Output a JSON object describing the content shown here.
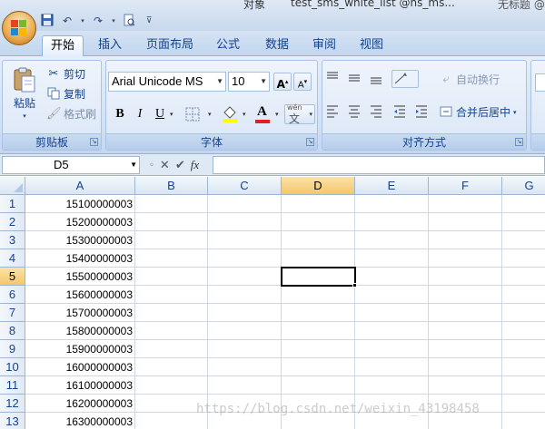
{
  "titlebar": {
    "partial_left_text": "对象",
    "file_name": "test_sms_white_list @ns_ms...",
    "partial_right_text": "无标题 @"
  },
  "qat": {
    "save_icon": "save-icon",
    "undo_icon": "undo-icon",
    "redo_icon": "redo-icon",
    "preview_icon": "print-preview-icon",
    "customize_icon": "customize-qat-icon"
  },
  "tabs": [
    "开始",
    "插入",
    "页面布局",
    "公式",
    "数据",
    "审阅",
    "视图"
  ],
  "active_tab": "开始",
  "clipboard": {
    "paste_label": "粘贴",
    "cut_label": "剪切",
    "copy_label": "复制",
    "format_painter_label": "格式刷",
    "group_label": "剪贴板"
  },
  "font": {
    "font_name": "Arial Unicode MS",
    "font_size": "10",
    "grow_label": "A",
    "shrink_label": "A",
    "bold_label": "B",
    "italic_label": "I",
    "underline_label": "U",
    "font_color_label": "A",
    "phonetic_label": "wén",
    "group_label": "字体",
    "font_color": "#e02020",
    "fill_color": "#ffff00"
  },
  "alignment": {
    "wrap_text_label": "自动换行",
    "merge_center_label": "合并后居中",
    "group_label": "对齐方式"
  },
  "formula_bar": {
    "name_box": "D5",
    "fx_label": "fx",
    "formula_value": ""
  },
  "sheet": {
    "columns": [
      "A",
      "B",
      "C",
      "D",
      "E",
      "F",
      "G"
    ],
    "selected_column": "D",
    "selected_row": "5",
    "rows": [
      {
        "num": "1",
        "a": "15100000003"
      },
      {
        "num": "2",
        "a": "15200000003"
      },
      {
        "num": "3",
        "a": "15300000003"
      },
      {
        "num": "4",
        "a": "15400000003"
      },
      {
        "num": "5",
        "a": "15500000003"
      },
      {
        "num": "6",
        "a": "15600000003"
      },
      {
        "num": "7",
        "a": "15700000003"
      },
      {
        "num": "8",
        "a": "15800000003"
      },
      {
        "num": "9",
        "a": "15900000003"
      },
      {
        "num": "10",
        "a": "16000000003"
      },
      {
        "num": "11",
        "a": "16100000003"
      },
      {
        "num": "12",
        "a": "16200000003"
      },
      {
        "num": "13",
        "a": "16300000003"
      }
    ]
  },
  "watermark": "https://blog.csdn.net/weixin_43198458"
}
